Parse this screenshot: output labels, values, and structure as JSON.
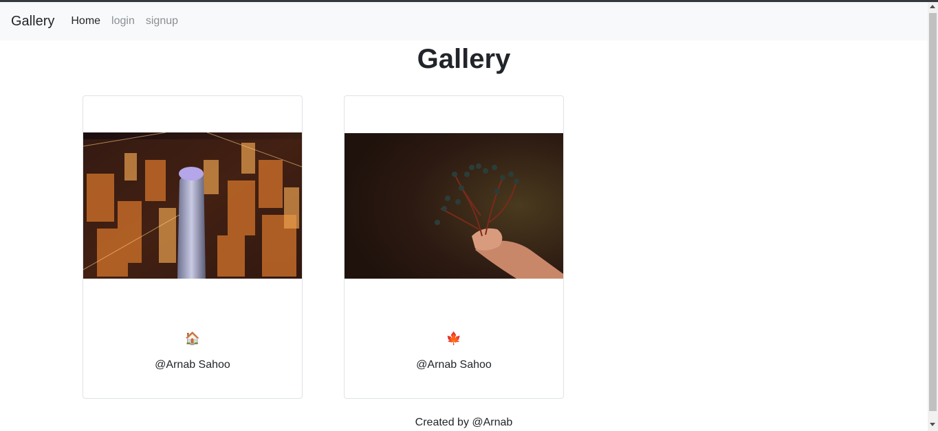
{
  "navbar": {
    "brand": "Gallery",
    "links": [
      {
        "label": "Home",
        "active": true
      },
      {
        "label": "login",
        "active": false
      },
      {
        "label": "signup",
        "active": false
      }
    ]
  },
  "page": {
    "title": "Gallery"
  },
  "cards": [
    {
      "image": "night city skyline aerial photo",
      "emoji": "🏠",
      "author": "@Arnab Sahoo"
    },
    {
      "image": "hand holding berry branch photo",
      "emoji": "🍁",
      "author": "@Arnab Sahoo"
    }
  ],
  "footer": {
    "text": "Created by @Arnab"
  }
}
